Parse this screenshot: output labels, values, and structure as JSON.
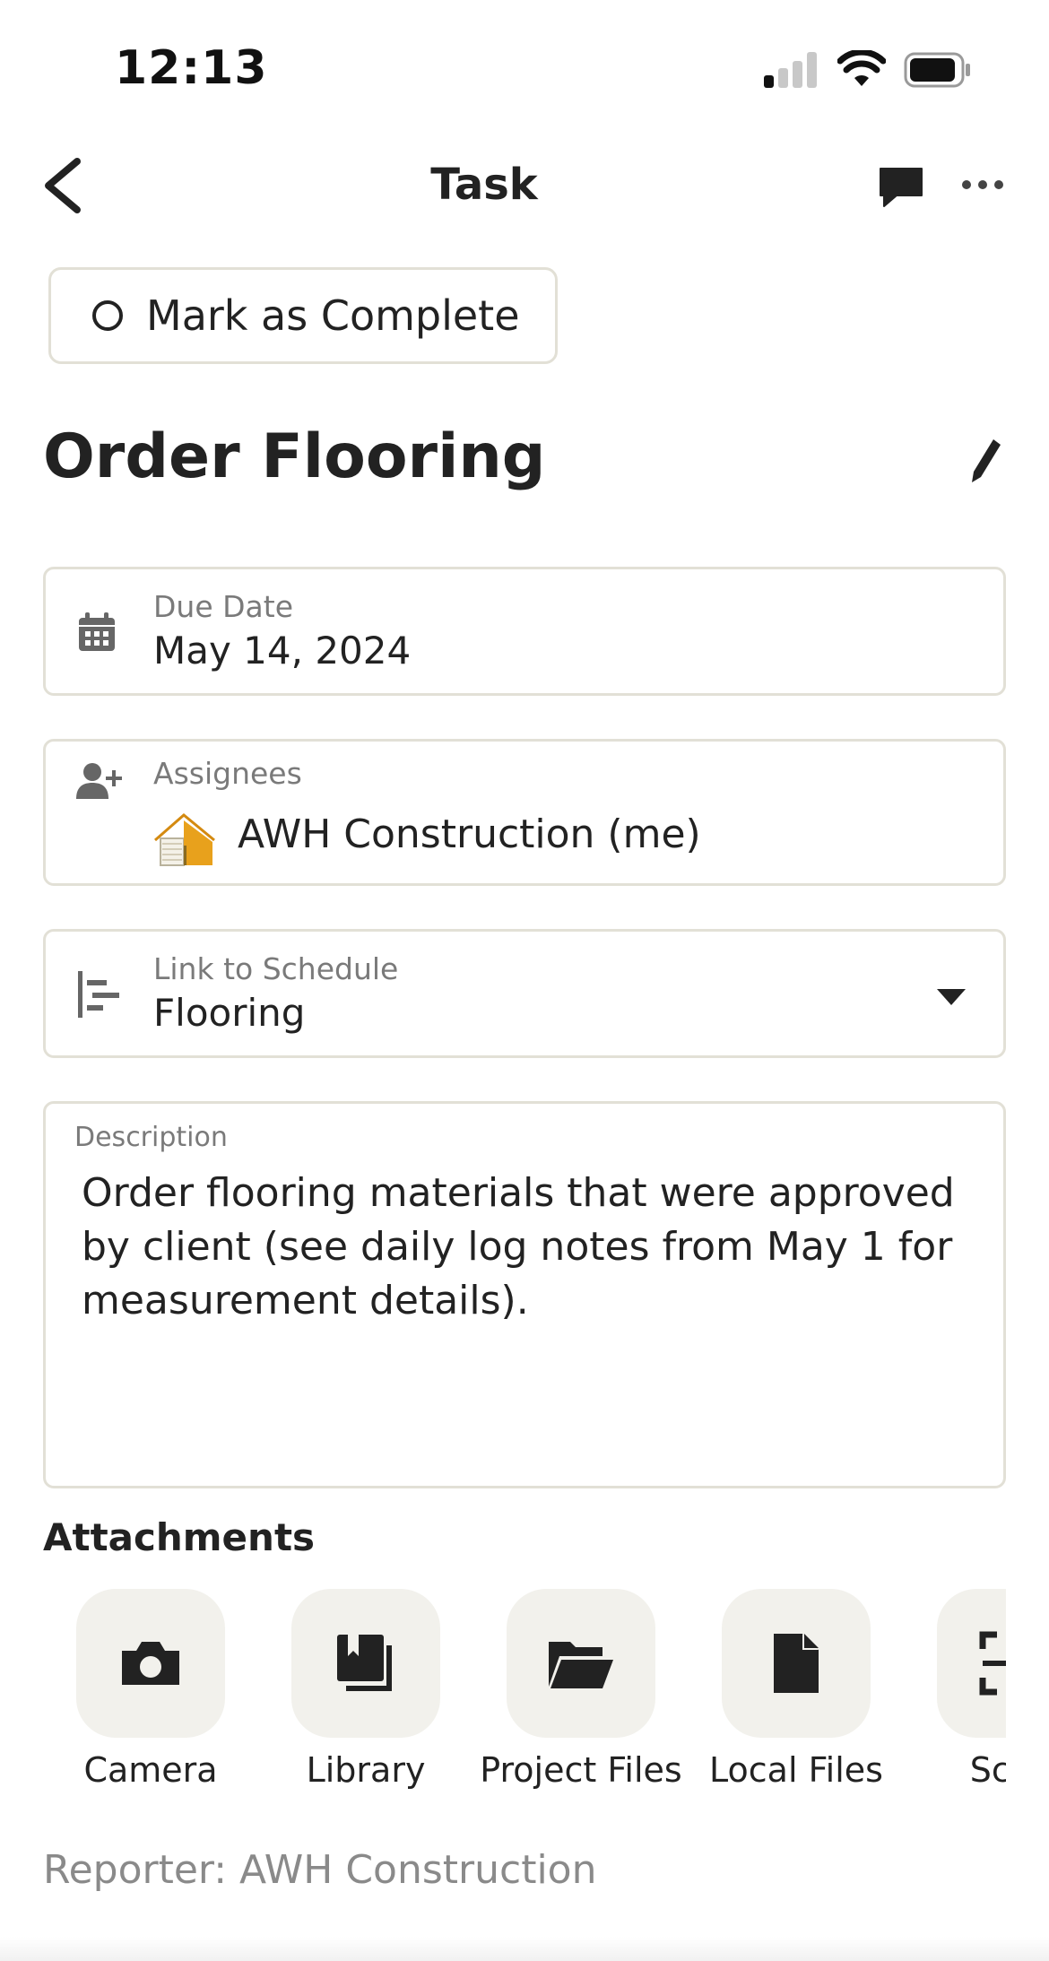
{
  "status_bar": {
    "time": "12:13"
  },
  "nav": {
    "title": "Task"
  },
  "complete_button": {
    "label": "Mark as Complete"
  },
  "task": {
    "title": "Order Flooring"
  },
  "due_date": {
    "label": "Due Date",
    "value": "May 14, 2024"
  },
  "assignees": {
    "label": "Assignees",
    "name": "AWH Construction (me)"
  },
  "link_schedule": {
    "label": "Link to Schedule",
    "value": "Flooring"
  },
  "description": {
    "label": "Description",
    "text": "Order flooring materials that were approved by client (see daily log notes from May 1 for measurement details)."
  },
  "attachments": {
    "title": "Attachments",
    "items": [
      {
        "label": "Camera",
        "icon": "camera-icon"
      },
      {
        "label": "Library",
        "icon": "library-icon"
      },
      {
        "label": "Project Files",
        "icon": "folder-icon"
      },
      {
        "label": "Local Files",
        "icon": "file-icon"
      },
      {
        "label": "Scan",
        "icon": "scan-icon"
      }
    ]
  },
  "reporter": {
    "text": "Reporter: AWH Construction"
  },
  "colors": {
    "border": "#e2e0d6",
    "tile": "#f2f1ec",
    "accent_orange": "#e8a11c",
    "muted_text": "#7a7a7a"
  }
}
